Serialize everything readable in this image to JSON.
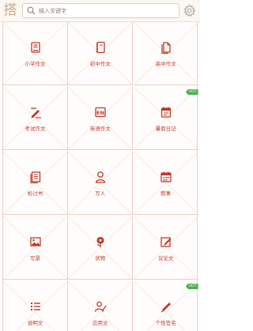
{
  "header": {
    "logo_char": "搭",
    "search_placeholder": "输入关键字"
  },
  "grid": {
    "items": [
      {
        "label": "小学作文",
        "icon": "book-icon"
      },
      {
        "label": "初中作文",
        "icon": "notebook-icon"
      },
      {
        "label": "高中作文",
        "icon": "pages-icon"
      },
      {
        "label": "考试作文",
        "icon": "exam-pen-icon"
      },
      {
        "label": "英语作文",
        "icon": "en-icon"
      },
      {
        "label": "暑假日记",
        "icon": "diary-icon",
        "badge": "HOT"
      },
      {
        "label": "检讨书",
        "icon": "document-icon"
      },
      {
        "label": "写人",
        "icon": "person-icon"
      },
      {
        "label": "叙事",
        "icon": "calendar-icon"
      },
      {
        "label": "写景",
        "icon": "landscape-icon"
      },
      {
        "label": "状物",
        "icon": "flower-icon"
      },
      {
        "label": "议论文",
        "icon": "edit-icon"
      },
      {
        "label": "说明文",
        "icon": "list-icon"
      },
      {
        "label": "应用文",
        "icon": "write-person-icon"
      },
      {
        "label": "个性签名",
        "icon": "pen-icon",
        "badge": "HOT"
      }
    ]
  },
  "colors": {
    "accent": "#c0392b",
    "grid_line": "#f0ccc4",
    "badge": "#4caf50"
  }
}
